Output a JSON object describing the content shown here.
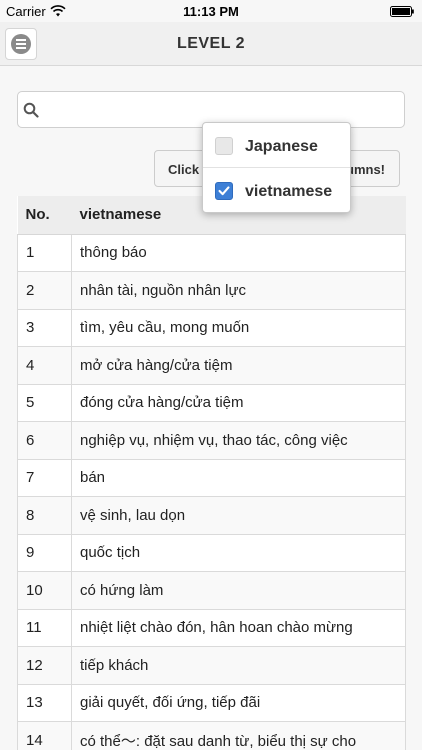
{
  "status_bar": {
    "carrier": "Carrier",
    "time": "11:13 PM"
  },
  "nav": {
    "title": "LEVEL 2",
    "menu_icon": "hamburger-menu-icon"
  },
  "search": {
    "value": "",
    "placeholder": "",
    "icon": "search-icon"
  },
  "columns_button": {
    "label_visible_left": "Click",
    "label_visible_right": "umns!"
  },
  "columns_dropdown": {
    "items": [
      {
        "label": "Japanese",
        "checked": false
      },
      {
        "label": "vietnamese",
        "checked": true
      }
    ]
  },
  "table": {
    "headers": [
      "No.",
      "vietnamese"
    ],
    "rows": [
      {
        "no": "1",
        "vi": "thông báo"
      },
      {
        "no": "2",
        "vi": "nhân tài, nguồn nhân lực"
      },
      {
        "no": "3",
        "vi": "tìm, yêu cầu, mong muốn"
      },
      {
        "no": "4",
        "vi": "mở cửa hàng/cửa tiệm"
      },
      {
        "no": "5",
        "vi": "đóng cửa hàng/cửa tiệm"
      },
      {
        "no": "6",
        "vi": "nghiệp vụ, nhiệm vụ, thao tác, công việc"
      },
      {
        "no": "7",
        "vi": "bán"
      },
      {
        "no": "8",
        "vi": "vệ sinh, lau dọn"
      },
      {
        "no": "9",
        "vi": "quốc tịch"
      },
      {
        "no": "10",
        "vi": "có hứng làm"
      },
      {
        "no": "11",
        "vi": "nhiệt liệt chào đón, hân hoan chào mừng"
      },
      {
        "no": "12",
        "vi": "tiếp khách"
      },
      {
        "no": "13",
        "vi": "giải quyết, đối ứng, tiếp đãi"
      },
      {
        "no": "14",
        "vi": "có thể～: đặt sau danh từ, biểu thị sự cho"
      }
    ]
  },
  "colors": {
    "accent_checkbox": "#3d7fd6",
    "header_bg": "#ededed",
    "nav_bg": "#f0f0f0"
  }
}
